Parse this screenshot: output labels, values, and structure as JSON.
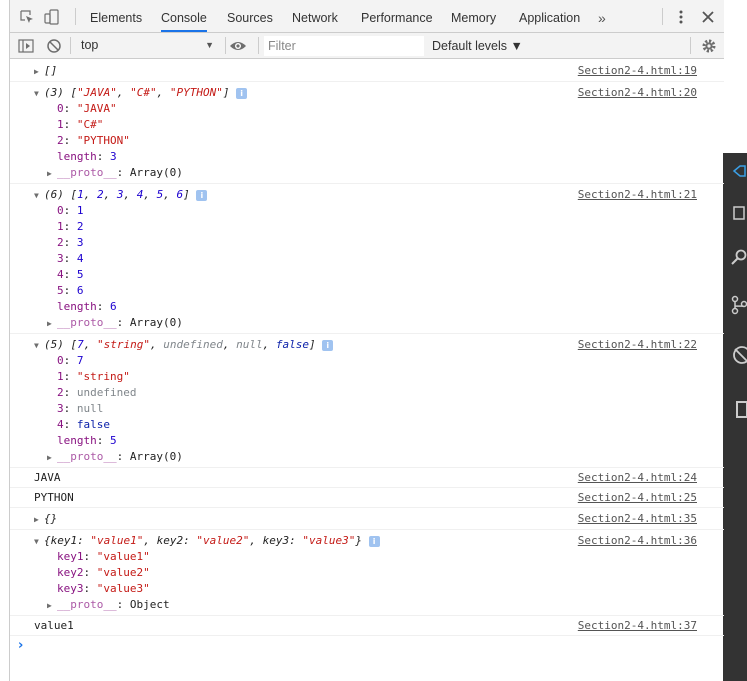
{
  "tabs": [
    {
      "label": "Elements",
      "active": false
    },
    {
      "label": "Console",
      "active": true
    },
    {
      "label": "Sources",
      "active": false
    },
    {
      "label": "Network",
      "active": false
    },
    {
      "label": "Performance",
      "active": false
    },
    {
      "label": "Memory",
      "active": false
    },
    {
      "label": "Application",
      "active": false
    }
  ],
  "toolbar": {
    "context": "top",
    "filter_placeholder": "Filter",
    "levels_label": "Default levels ▼"
  },
  "sources": {
    "l19": "Section2-4.html:19",
    "l20": "Section2-4.html:20",
    "l21": "Section2-4.html:21",
    "l22": "Section2-4.html:22",
    "l24": "Section2-4.html:24",
    "l25": "Section2-4.html:25",
    "l35": "Section2-4.html:35",
    "l36": "Section2-4.html:36",
    "l37": "Section2-4.html:37"
  },
  "messages": {
    "empty_array": "[]",
    "arr1": {
      "count": "(3)",
      "items": [
        "\"JAVA\"",
        "\"C#\"",
        "\"PYTHON\""
      ],
      "length": "3"
    },
    "arr2": {
      "count": "(6)",
      "items": [
        "1",
        "2",
        "3",
        "4",
        "5",
        "6"
      ],
      "length": "6"
    },
    "arr3": {
      "count": "(5)",
      "items": [
        "7",
        "\"string\"",
        "undefined",
        "null",
        "false"
      ],
      "length": "5"
    },
    "java": "JAVA",
    "python": "PYTHON",
    "empty_object": "{}",
    "obj": {
      "keys": [
        "key1",
        "key2",
        "key3"
      ],
      "values": [
        "\"value1\"",
        "\"value2\"",
        "\"value3\""
      ]
    },
    "value1": "value1",
    "proto_key": "__proto__",
    "proto_array": "Array(0)",
    "proto_object": "Object",
    "length_key": "length"
  }
}
